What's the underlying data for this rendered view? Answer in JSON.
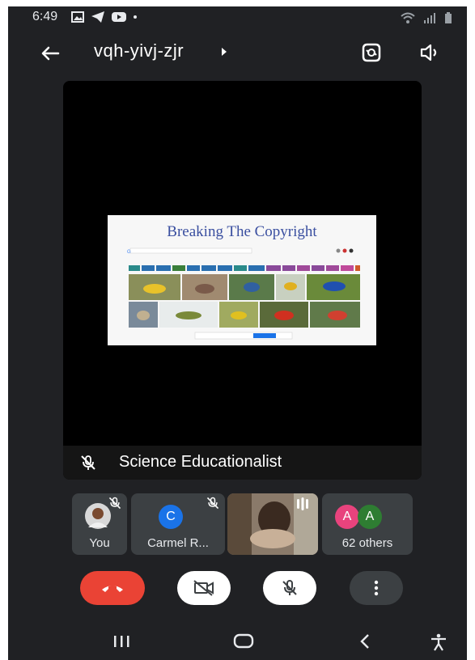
{
  "status_bar": {
    "time": "6:49"
  },
  "meeting": {
    "code": "vqh-yivj-zjr"
  },
  "presenter": {
    "name": "Science Educationalist"
  },
  "slide": {
    "title": "Breaking The Copyright"
  },
  "participants": {
    "you": {
      "label": "You"
    },
    "carmel": {
      "initial": "C",
      "label": "Carmel R..."
    },
    "others": {
      "avatar1": "A",
      "avatar2": "A",
      "label": "62 others"
    }
  },
  "colors": {
    "background": "#202124",
    "tile": "#3c4043",
    "end_call": "#ea4335",
    "carmel_avatar": "#1a73e8",
    "avatar_pink": "#e8437d",
    "avatar_green": "#2e7d32"
  },
  "icons": [
    "back-arrow-icon",
    "switch-camera-icon",
    "speaker-icon",
    "mic-off-icon",
    "camera-off-icon",
    "end-call-icon",
    "more-icon"
  ]
}
